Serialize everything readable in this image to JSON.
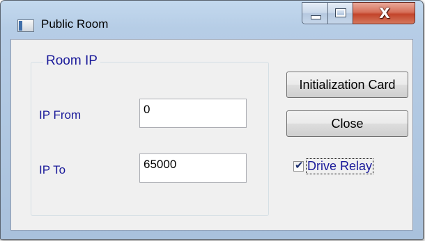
{
  "window": {
    "title": "Public Room",
    "icon": "app-window-icon",
    "controls": {
      "minimize": "minimize-icon",
      "maximize": "maximize-icon",
      "close_glyph": "X"
    }
  },
  "room_ip": {
    "group_title": "Room IP",
    "ip_from": {
      "label": "IP From",
      "value": "0"
    },
    "ip_to": {
      "label": "IP To",
      "value": "65000"
    }
  },
  "buttons": {
    "initialization_card": "Initialization Card",
    "close": "Close"
  },
  "drive_relay": {
    "label": "Drive Relay",
    "checked": true,
    "check_glyph": "✔"
  },
  "colors": {
    "label_text": "#1a1a9a",
    "close_button": "#c3442b",
    "title_bar": "#b6cde6"
  }
}
